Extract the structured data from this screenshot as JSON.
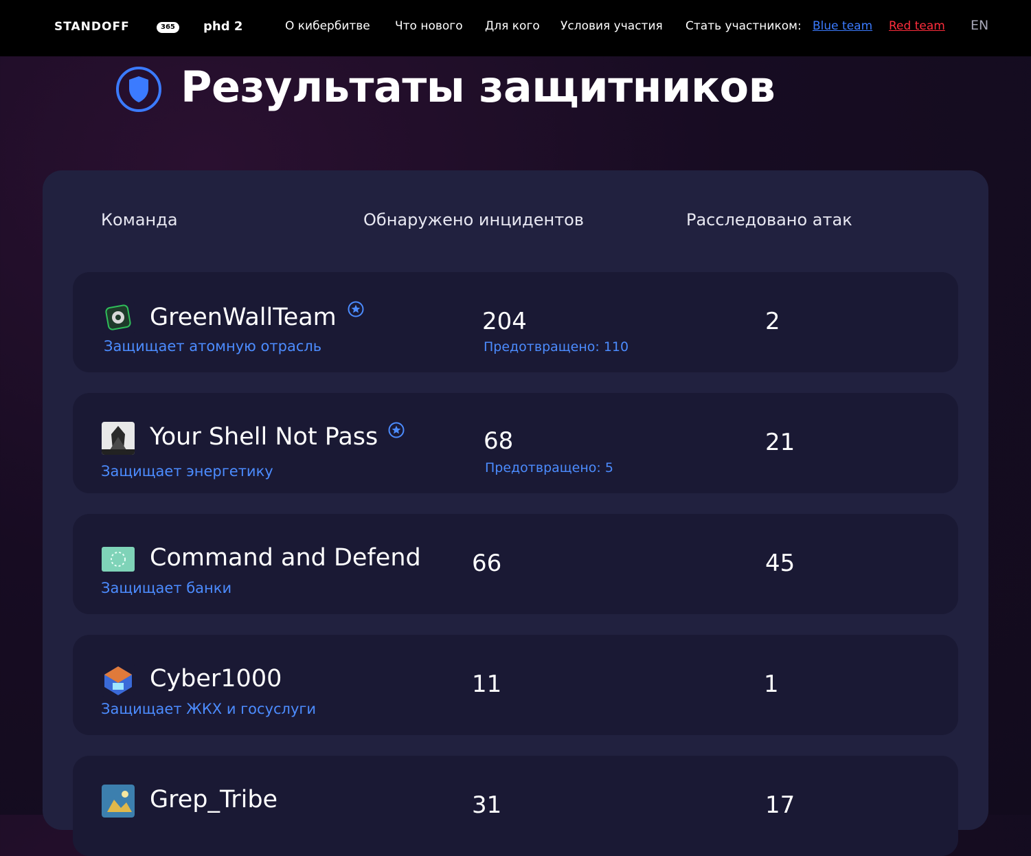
{
  "header": {
    "logo_text": "STANDOFF",
    "logo_badge": "365",
    "logo_phd": "phd 2",
    "nav": [
      "О кибербитве",
      "Что нового",
      "Для кого",
      "Условия участия"
    ],
    "join_label": "Стать участником:",
    "blue_team": "Blue team",
    "red_team": "Red team",
    "lang": "EN",
    "colors": {
      "blue_link": "#3b7bff",
      "red_link": "#ff2d3c"
    }
  },
  "page": {
    "title": "Результаты защитников",
    "title_icon": "shield-icon"
  },
  "table": {
    "columns": [
      "Команда",
      "Обнаружено инцидентов",
      "Расследовано атак"
    ],
    "prevented_label": "Предотвращено:",
    "rows": [
      {
        "name": "GreenWallTeam",
        "sector": "Защищает атомную отрасль",
        "incidents": "204",
        "prevented": "110",
        "attacks": "2",
        "starred": true
      },
      {
        "name": "Your Shell Not Pass",
        "sector": "Защищает энергетику",
        "incidents": "68",
        "prevented": "5",
        "attacks": "21",
        "starred": true
      },
      {
        "name": "Command and Defend",
        "sector": "Защищает банки",
        "incidents": "66",
        "prevented": null,
        "attacks": "45",
        "starred": false
      },
      {
        "name": "Cyber1000",
        "sector": "Защищает ЖКХ и госуслуги",
        "incidents": "11",
        "prevented": null,
        "attacks": "1",
        "starred": false
      },
      {
        "name": "Grep_Tribe",
        "sector": "",
        "incidents": "31",
        "prevented": null,
        "attacks": "17",
        "starred": false
      }
    ]
  },
  "colors": {
    "accent_blue": "#4c8cff",
    "panel": "#21213f",
    "row": "#1a1934"
  }
}
